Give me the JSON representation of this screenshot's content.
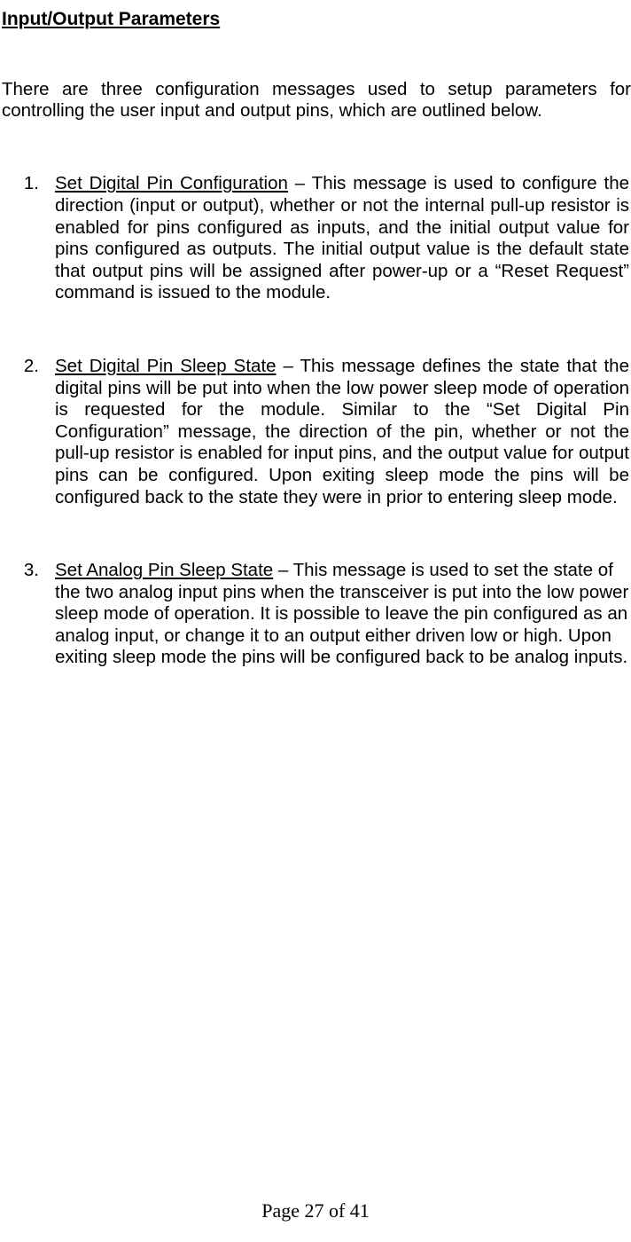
{
  "heading": "Input/Output Parameters",
  "intro": "There are three configuration messages used to setup parameters for controlling the user input and output pins, which are outlined below.",
  "items": [
    {
      "num": "1.",
      "term": "Set Digital Pin Configuration",
      "rest": " – This message is used to configure the direction (input or output), whether or not the internal pull-up resistor is enabled for pins configured as inputs, and the initial output value for pins configured as outputs.  The initial output value is the default state that output pins will be assigned after power-up or a “Reset Request” command is issued to the module.",
      "justify": true
    },
    {
      "num": "2.",
      "term": "Set Digital Pin Sleep State",
      "rest": " – This message defines the state that the digital pins will be put into when the low power sleep mode of operation is requested for the module.  Similar to the “Set Digital Pin Configuration” message, the direction of the pin, whether or not the pull-up resistor is enabled for input pins, and the output value for output pins can be configured.  Upon exiting sleep mode the pins will be configured back to the state they were in prior to entering sleep mode.",
      "justify": true
    },
    {
      "num": "3.",
      "term": "Set Analog Pin Sleep State",
      "rest": " – This message is used to set the state of the two analog input pins when the transceiver is put into the low power sleep mode of operation.  It is possible to leave the pin configured as an analog input, or change it to an output either driven low or high.  Upon exiting sleep mode the pins will be configured back to be analog inputs.",
      "justify": false
    }
  ],
  "footer": "Page 27 of 41"
}
